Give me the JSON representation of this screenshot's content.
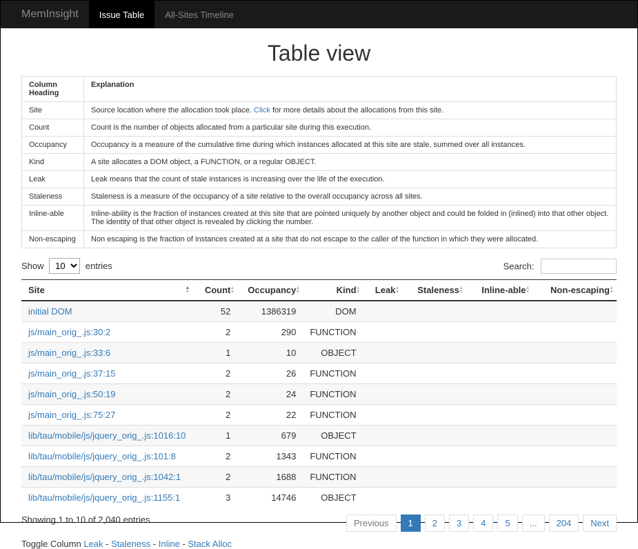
{
  "navbar": {
    "brand": "MemInsight",
    "items": [
      "Issue Table",
      "All-Sites Timeline"
    ],
    "active_index": 0
  },
  "page_title": "Table view",
  "definitions": {
    "header_col1": "Column Heading",
    "header_col2": "Explanation",
    "rows": [
      {
        "col": "Site",
        "exp_pre": "Source location where the allocation took place. ",
        "link": "Click",
        "exp_post": " for more details about the allocations from this site."
      },
      {
        "col": "Count",
        "exp": "Count is the number of objects allocated from a particular site during this execution."
      },
      {
        "col": "Occupancy",
        "exp": "Occupancy is a measure of the cumulative time during which instances allocated at this site are stale, summed over all instances."
      },
      {
        "col": "Kind",
        "exp": "A site allocates a DOM object, a FUNCTION, or a regular OBJECT."
      },
      {
        "col": "Leak",
        "exp": "Leak means that the count of stale instances is increasing over the life of the execution."
      },
      {
        "col": "Staleness",
        "exp": "Staleness is a measure of the occupancy of a site relative to the overall occupancy across all sites."
      },
      {
        "col": "Inline-able",
        "exp": "Inline-ability is the fraction of instances created at this site that are pointed uniquely by another object and could be folded in (inlined) into that other object. The identity of that other object is revealed by clicking the number."
      },
      {
        "col": "Non-escaping",
        "exp": "Non escaping is the fraction of instances created at a site that do not escape to the caller of the function in which they were allocated."
      }
    ]
  },
  "length_menu": {
    "show": "Show",
    "value": "10",
    "entries": "entries"
  },
  "search": {
    "label": "Search:",
    "value": ""
  },
  "columns": [
    "Site",
    "Count",
    "Occupancy",
    "Kind",
    "Leak",
    "Staleness",
    "Inline-able",
    "Non-escaping"
  ],
  "rows": [
    {
      "site": "initial DOM",
      "count": "52",
      "occupancy": "1386319",
      "kind": "DOM"
    },
    {
      "site": "js/main_orig_.js:30:2",
      "count": "2",
      "occupancy": "290",
      "kind": "FUNCTION"
    },
    {
      "site": "js/main_orig_.js:33:6",
      "count": "1",
      "occupancy": "10",
      "kind": "OBJECT"
    },
    {
      "site": "js/main_orig_.js:37:15",
      "count": "2",
      "occupancy": "26",
      "kind": "FUNCTION"
    },
    {
      "site": "js/main_orig_.js:50:19",
      "count": "2",
      "occupancy": "24",
      "kind": "FUNCTION"
    },
    {
      "site": "js/main_orig_.js:75:27",
      "count": "2",
      "occupancy": "22",
      "kind": "FUNCTION"
    },
    {
      "site": "lib/tau/mobile/js/jquery_orig_.js:1016:10",
      "count": "1",
      "occupancy": "679",
      "kind": "OBJECT"
    },
    {
      "site": "lib/tau/mobile/js/jquery_orig_.js:101:8",
      "count": "2",
      "occupancy": "1343",
      "kind": "FUNCTION"
    },
    {
      "site": "lib/tau/mobile/js/jquery_orig_.js:1042:1",
      "count": "2",
      "occupancy": "1688",
      "kind": "FUNCTION"
    },
    {
      "site": "lib/tau/mobile/js/jquery_orig_.js:1155:1",
      "count": "3",
      "occupancy": "14746",
      "kind": "OBJECT"
    }
  ],
  "info": "Showing 1 to 10 of 2,040 entries",
  "pager": {
    "prev": "Previous",
    "next": "Next",
    "pages": [
      "1",
      "2",
      "3",
      "4",
      "5",
      "...",
      "204"
    ],
    "active_index": 0
  },
  "toggle": {
    "label": "Toggle Column ",
    "links": [
      "Leak",
      "Staleness",
      "Inline",
      "Stack Alloc"
    ],
    "sep": " - "
  }
}
